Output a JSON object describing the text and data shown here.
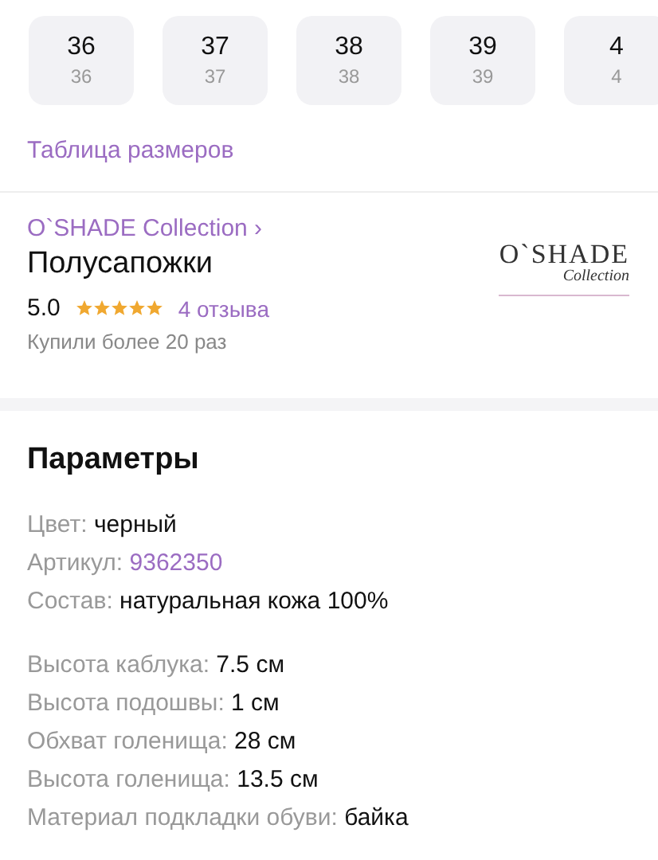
{
  "sizes": [
    {
      "size": "36",
      "sub": "36"
    },
    {
      "size": "37",
      "sub": "37"
    },
    {
      "size": "38",
      "sub": "38"
    },
    {
      "size": "39",
      "sub": "39"
    },
    {
      "size": "4",
      "sub": "4"
    }
  ],
  "size_table_link": "Таблица размеров",
  "product": {
    "brand_link": "O`SHADE Collection ›",
    "title": "Полусапожки",
    "rating": "5.0",
    "stars": 5,
    "reviews_link": "4 отзыва",
    "purchases": "Купили более 20 раз",
    "logo": {
      "name": "O`SHADE",
      "sub": "Collection"
    }
  },
  "parameters": {
    "heading": "Параметры",
    "groups": [
      [
        {
          "label": "Цвет:",
          "value": "черный",
          "kind": "plain"
        },
        {
          "label": "Артикул:",
          "value": "9362350",
          "kind": "link"
        },
        {
          "label": "Состав:",
          "value": "натуральная кожа 100%",
          "kind": "plain"
        }
      ],
      [
        {
          "label": "Высота каблука:",
          "value": "7.5 см",
          "kind": "plain"
        },
        {
          "label": "Высота подошвы:",
          "value": "1 см",
          "kind": "plain"
        },
        {
          "label": "Обхват голенища:",
          "value": "28 см",
          "kind": "plain"
        },
        {
          "label": "Высота голенища:",
          "value": "13.5 см",
          "kind": "plain"
        },
        {
          "label": "Материал подкладки обуви:",
          "value": "байка",
          "kind": "plain"
        }
      ]
    ]
  }
}
